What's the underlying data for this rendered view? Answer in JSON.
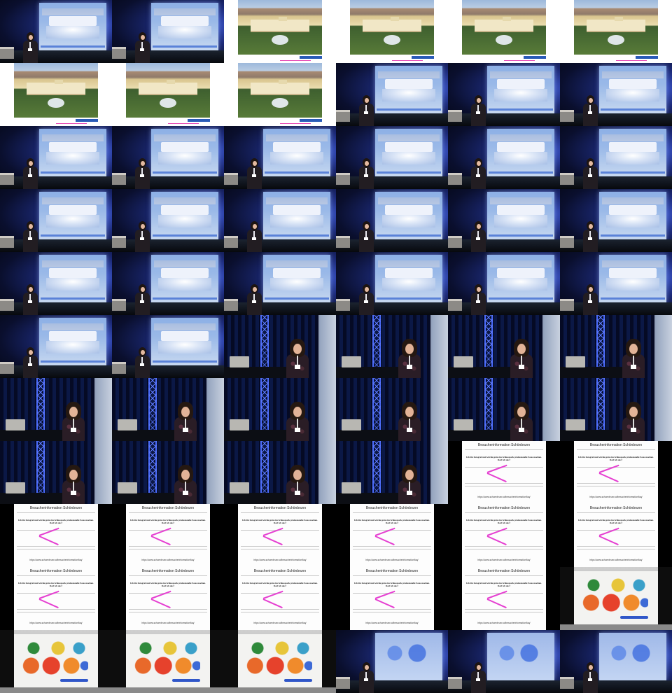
{
  "sheet": {
    "columns": 6,
    "rows": 11,
    "cells": [
      "stage",
      "stage",
      "photo",
      "photo",
      "photo",
      "photo",
      "photo",
      "photo",
      "photo",
      "stage",
      "stage",
      "stage",
      "stage",
      "stage",
      "stage",
      "stage",
      "stage",
      "stage",
      "stage",
      "stage",
      "stage",
      "stage",
      "stage",
      "stage",
      "stage",
      "stage",
      "stage",
      "stage",
      "stage",
      "stage",
      "stage",
      "stage",
      "live",
      "live",
      "live",
      "live",
      "live",
      "live",
      "live",
      "live",
      "live",
      "live",
      "live",
      "live",
      "live",
      "live",
      "web",
      "web",
      "web",
      "web",
      "web",
      "web",
      "web",
      "web",
      "web",
      "web",
      "web",
      "web",
      "web",
      "graffiti",
      "graffiti",
      "graffiti",
      "graffiti",
      "stage-graffiti",
      "stage-graffiti",
      "stage-graffiti"
    ]
  },
  "webpage_slide": {
    "title": "Besucherinformation Schönbrunn",
    "heading": "Ich bin Fotograf und würde gerne im Schlosspark professionelle Fotos machen. Darf ich das?",
    "url": "https://www.schoenbrunn.at/besucherinformation/faq/"
  },
  "colors": {
    "stage_blue": "#1c2a78",
    "truss_blue": "#4a6cff",
    "annotation_arrow": "#e53fd1",
    "button_blue": "#2a5bb8"
  }
}
